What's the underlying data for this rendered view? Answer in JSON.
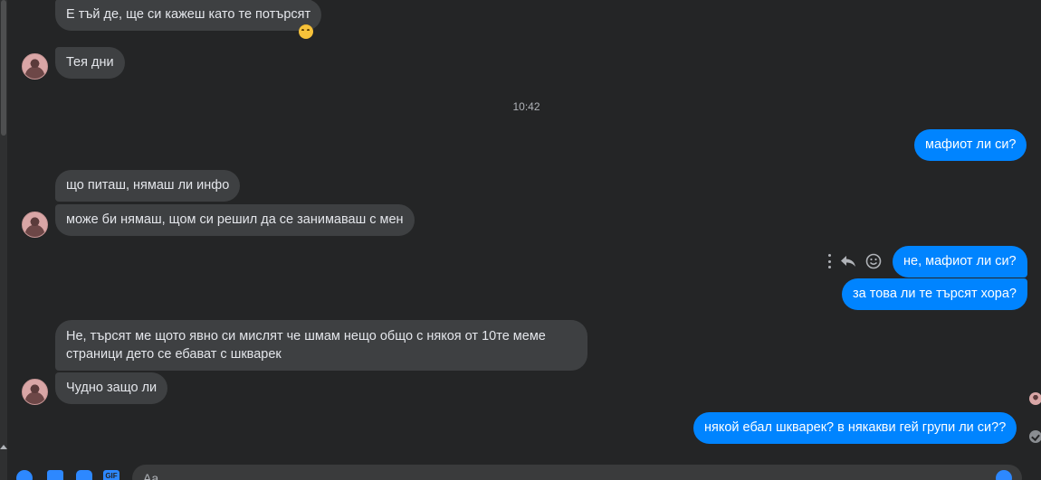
{
  "messages": [
    {
      "text": "Е тъй де, ще си кажеш като те потърсят",
      "direction": "in"
    },
    {
      "text": "Тея дни",
      "direction": "in"
    },
    {
      "text": "мафиот ли си?",
      "direction": "out"
    },
    {
      "text": "що питаш, нямаш ли инфо",
      "direction": "in"
    },
    {
      "text": "може би нямаш, щом си решил да се занимаваш с мен",
      "direction": "in"
    },
    {
      "text": "не, мафиот ли си?",
      "direction": "out"
    },
    {
      "text": "за това ли те търсят хора?",
      "direction": "out"
    },
    {
      "text": "Не, търсят ме щото явно си мислят че шмам нещо общо с някоя от 10те меме",
      "text2": "страници дето се ебават с шкварек",
      "direction": "in"
    },
    {
      "text": "Чудно защо ли",
      "direction": "in"
    },
    {
      "text": "някой ебал шкварек? в някакви гей групи ли си??",
      "direction": "out"
    }
  ],
  "timestamp": "10:42",
  "reaction_emoji": "grinning-squinting-face",
  "composer": {
    "input_value": "",
    "placeholder": "Aa",
    "icons": [
      "plus-icon",
      "photo-icon",
      "sticker-icon",
      "gif-icon",
      "emoji-icon"
    ],
    "gif_label": "GIF"
  },
  "hover_actions": {
    "icons": [
      "more-icon",
      "reply-icon",
      "react-icon"
    ]
  },
  "colors": {
    "background": "#242526",
    "incoming_bubble": "#3e4042",
    "outgoing_bubble": "#0084ff",
    "text": "#e4e6eb",
    "muted": "#b0b3b8"
  }
}
